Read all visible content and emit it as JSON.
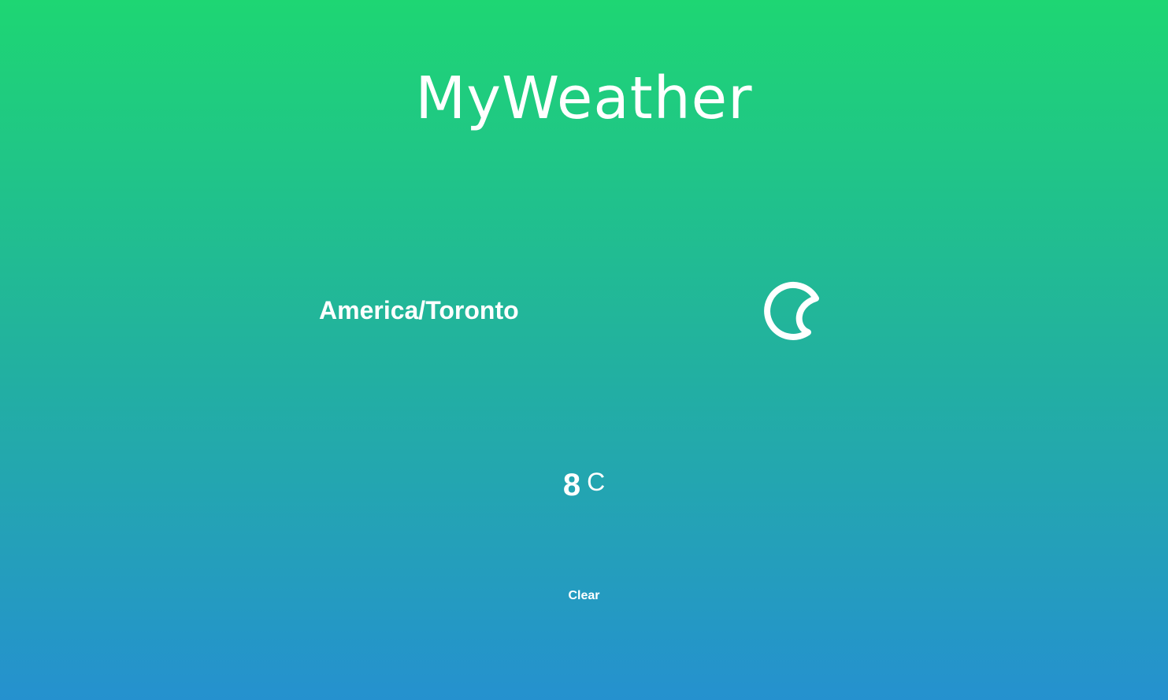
{
  "app": {
    "title": "MyWeather"
  },
  "location": {
    "timezone": "America/Toronto"
  },
  "weather": {
    "icon": "moon-icon",
    "temperature": "8",
    "unit": "C",
    "description": "Clear"
  },
  "colors": {
    "gradient_top": "#1ed673",
    "gradient_bottom": "#2591cf",
    "text": "#ffffff"
  }
}
